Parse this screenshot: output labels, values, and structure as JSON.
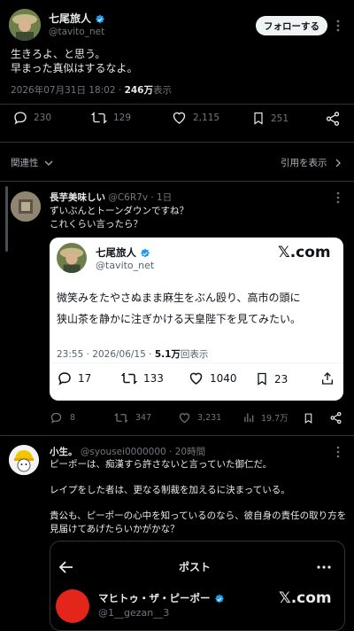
{
  "main_post": {
    "author_name": "七尾旅人",
    "handle": "@tavito_net",
    "follow_label": "フォローする",
    "text_line1": "生きろよ、と思う。",
    "text_line2": "早まった真似はするなよ。",
    "timestamp": "2026年07月31日 18:02 · ",
    "views_count": "246万",
    "views_label": "表示",
    "replies": "230",
    "reposts": "129",
    "likes": "2,115",
    "bookmarks": "251"
  },
  "replies_header": {
    "sort_label": "関連性",
    "view_quotes": "引用を表示"
  },
  "reply1": {
    "author_name": "長芋美味しい",
    "handle_time": "@C6R7v · 1日",
    "text_line1": "ずいぶんとトーンダウンですね？",
    "text_line2": "これくらい言ったら？",
    "embedded": {
      "author_name": "七尾旅人",
      "handle": "@tavito_net",
      "brand": "𝕏.com",
      "text_line1": "微笑みをたやさぬまま麻生をぶん殴り、高市の頭に",
      "text_line2": "狭山茶を静かに注ぎかける天皇陛下を見てみたい。",
      "timestamp": "23:55 · 2026/06/15 · ",
      "views_count": "5.1万",
      "views_label": "回表示",
      "replies": "17",
      "reposts": "133",
      "likes": "1040",
      "bookmarks": "23"
    },
    "replies": "8",
    "reposts": "347",
    "likes": "3,231",
    "views": "19.7万"
  },
  "reply2": {
    "author_name": "小生。",
    "handle_time": "@syousei0000000 · 20時間",
    "text_line1": "ピーポーは、痴漢すら許さないと言っていた御仁だ。",
    "text_line2": "レイプをした者は、更なる制裁を加えるに決まっている。",
    "text_line3": "貴公も、ピーポーの心中を知っているのなら、彼自身の責任の取り方を",
    "text_line4": "見届けてあげたらいかがかな？",
    "embedded": {
      "header_title": "ポスト",
      "author_name": "マヒトゥ・ザ・ピーポー",
      "handle": "@1__gezan__3",
      "brand": "𝕏.com"
    }
  },
  "colors": {
    "background": "#000000",
    "text": "#e7e9ea",
    "muted": "#71767b",
    "verified": "#1d9bf0",
    "divider": "#2f3336"
  }
}
